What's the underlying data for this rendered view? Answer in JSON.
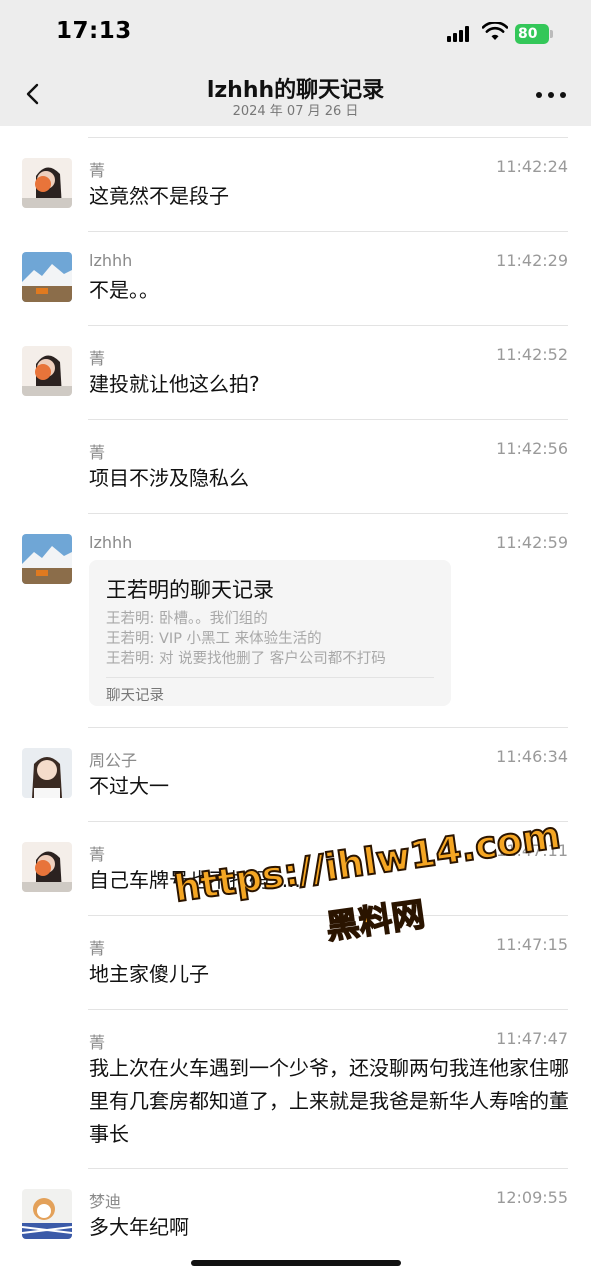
{
  "status_bar": {
    "time": "17:13",
    "battery": "80"
  },
  "header": {
    "title": "lzhhh的聊天记录",
    "subtitle": "2024 年 07 月 26 日"
  },
  "messages": [
    {
      "sender": "菁",
      "time": "11:42:24",
      "text": "这竟然不是段子"
    },
    {
      "sender": "lzhhh",
      "time": "11:42:29",
      "text": "不是。。"
    },
    {
      "sender": "菁",
      "time": "11:42:52",
      "text": "建投就让他这么拍?"
    },
    {
      "sender": "菁",
      "time": "11:42:56",
      "text": "项目不涉及隐私么"
    },
    {
      "sender": "lzhhh",
      "time": "11:42:59"
    },
    {
      "sender": "周公子",
      "time": "11:46:34",
      "text": "不过大一"
    },
    {
      "sender": "菁",
      "time": "11:47:11",
      "text": "自己车牌号也不打码......"
    },
    {
      "sender": "菁",
      "time": "11:47:15",
      "text": "地主家傻儿子"
    },
    {
      "sender": "菁",
      "time": "11:47:47",
      "text": "我上次在火车遇到一个少爷，还没聊两句我连他家住哪里有几套房都知道了，上来就是我爸是新华人寿啥的董事长"
    },
    {
      "sender": "梦迪",
      "time": "12:09:55",
      "text": "多大年纪啊"
    }
  ],
  "chat_card": {
    "title": "王若明的聊天记录",
    "lines": [
      "王若明: 卧槽。。我们组的",
      "王若明: VIP 小黑工 来体验生活的",
      "王若明: 对 说要找他删了 客户公司都不打码"
    ],
    "footer": "聊天记录"
  },
  "watermark": {
    "url": "https://ihlw14.com",
    "label": "黑料网"
  },
  "colors": {
    "battery": "#34c759",
    "header_bg": "#ededed",
    "watermark": "#f5a623"
  },
  "icons": [
    "back-arrow-icon",
    "more-icon",
    "signal-icon",
    "wifi-icon",
    "battery-icon"
  ]
}
